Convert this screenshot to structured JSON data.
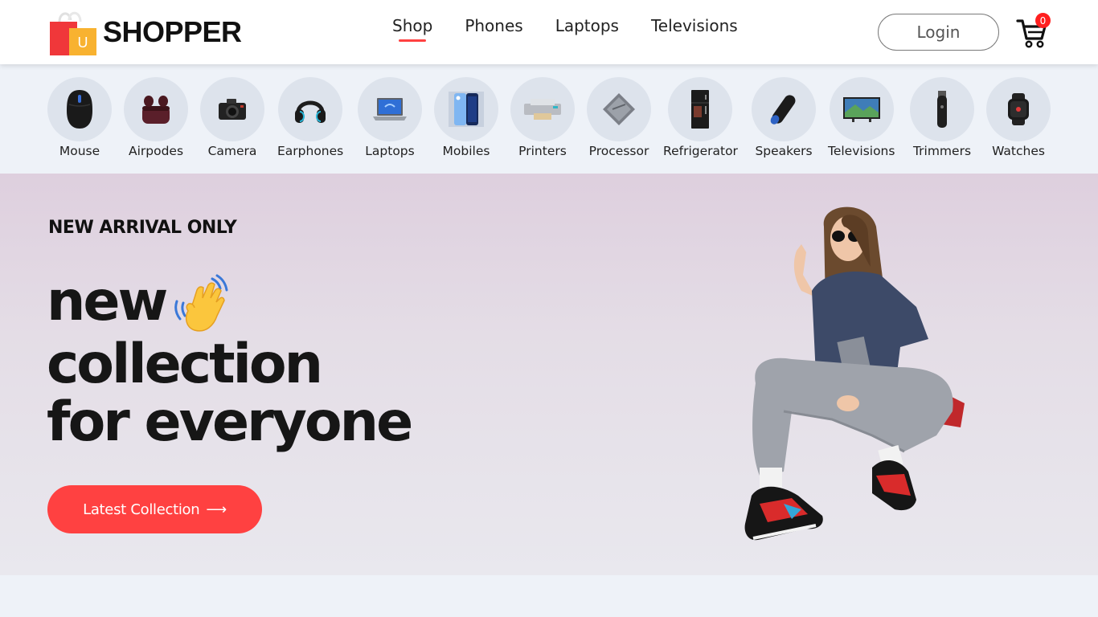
{
  "brand": {
    "name": "SHOPPER",
    "badge_letter": "U"
  },
  "nav": {
    "items": [
      {
        "label": "Shop",
        "active": true
      },
      {
        "label": "Phones",
        "active": false
      },
      {
        "label": "Laptops",
        "active": false
      },
      {
        "label": "Televisions",
        "active": false
      }
    ]
  },
  "header": {
    "login_label": "Login",
    "cart_count": "0"
  },
  "categories": [
    {
      "label": "Mouse",
      "icon": "mouse-icon"
    },
    {
      "label": "Airpodes",
      "icon": "airpods-icon"
    },
    {
      "label": "Camera",
      "icon": "camera-icon"
    },
    {
      "label": "Earphones",
      "icon": "headphones-icon"
    },
    {
      "label": "Laptops",
      "icon": "laptop-icon"
    },
    {
      "label": "Mobiles",
      "icon": "mobile-icon"
    },
    {
      "label": "Printers",
      "icon": "printer-icon"
    },
    {
      "label": "Processor",
      "icon": "processor-icon"
    },
    {
      "label": "Refrigerator",
      "icon": "refrigerator-icon"
    },
    {
      "label": "Speakers",
      "icon": "speaker-icon"
    },
    {
      "label": "Televisions",
      "icon": "television-icon"
    },
    {
      "label": "Trimmers",
      "icon": "trimmer-icon"
    },
    {
      "label": "Watches",
      "icon": "watch-icon"
    }
  ],
  "hero": {
    "kicker": "NEW ARRIVAL ONLY",
    "line1": "new",
    "line2": "collection",
    "line3": "for everyone",
    "cta_label": "Latest Collection",
    "cta_arrow": "⟶"
  },
  "colors": {
    "accent": "#ff4141",
    "page_bg": "#eef2f8",
    "category_circle": "#dde3ec",
    "hero_top": "#decfde",
    "hero_bottom": "#e9e8ee"
  }
}
